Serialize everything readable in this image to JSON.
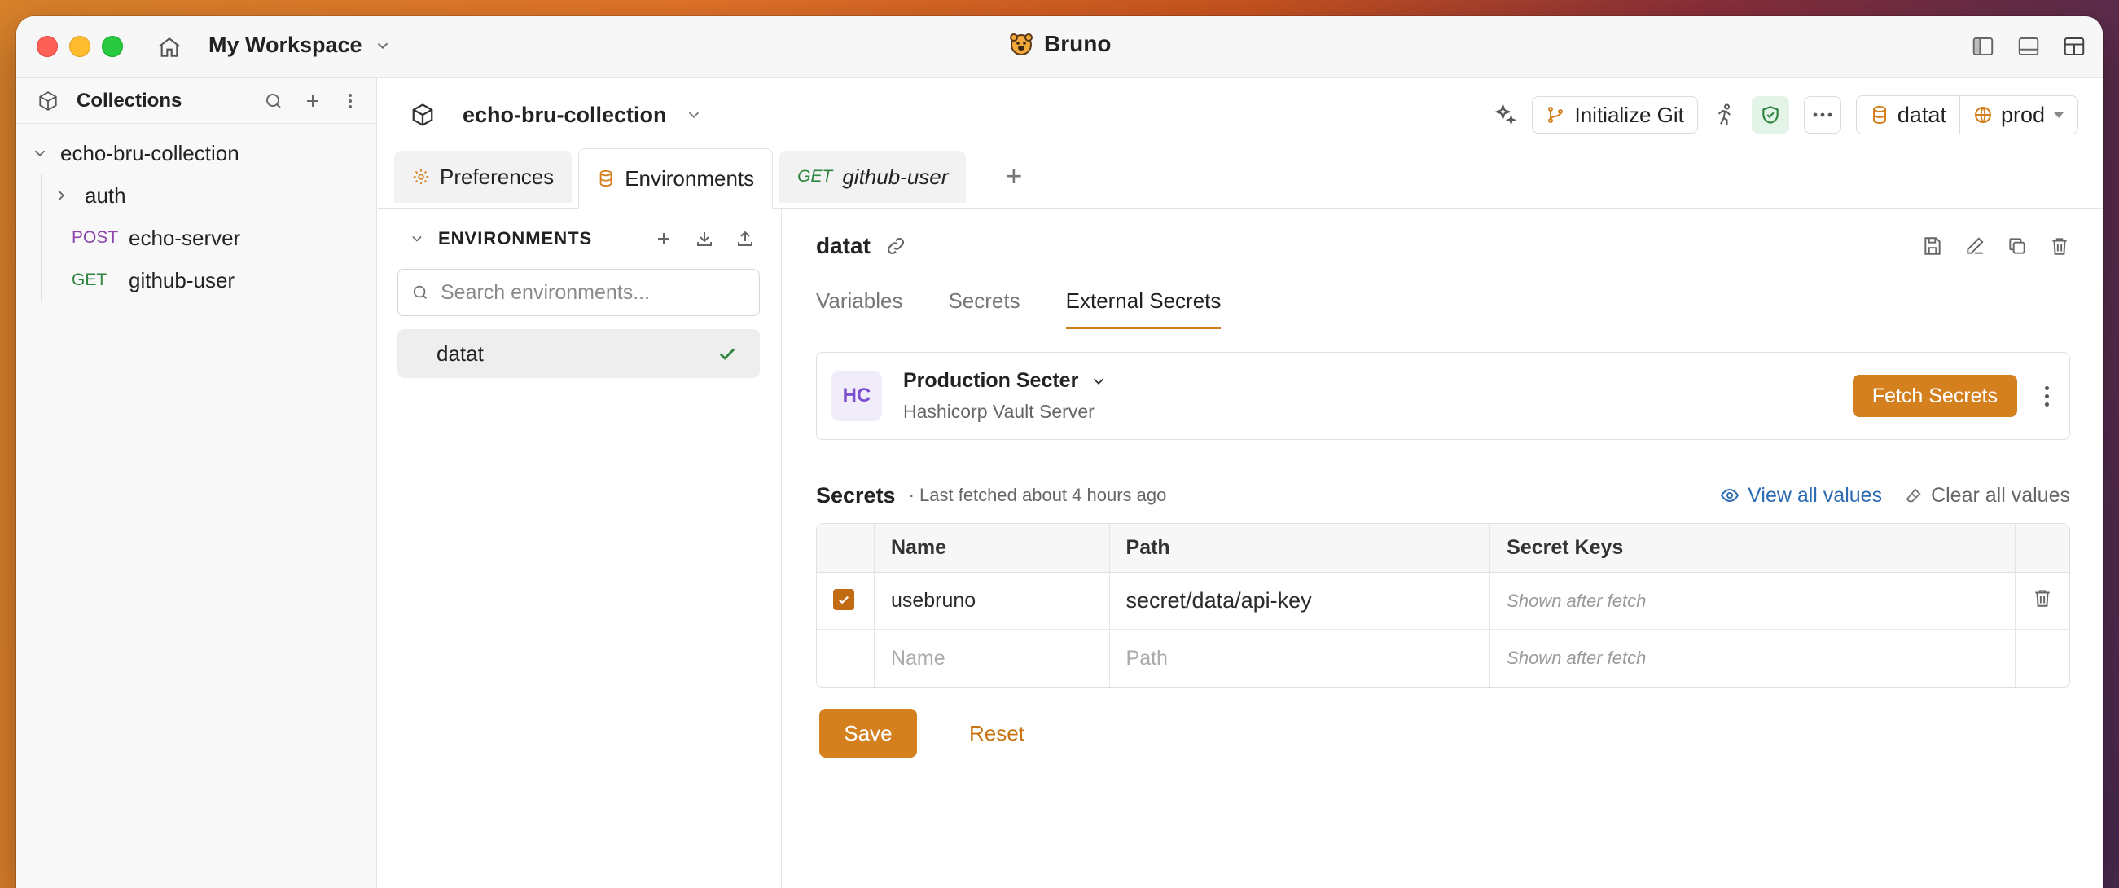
{
  "titlebar": {
    "workspace": "My Workspace",
    "app_name": "Bruno"
  },
  "sidebar": {
    "title": "Collections",
    "collection": "echo-bru-collection",
    "items": [
      {
        "method": "",
        "label": "auth"
      },
      {
        "method": "POST",
        "label": "echo-server"
      },
      {
        "method": "GET",
        "label": "github-user"
      }
    ]
  },
  "topbar": {
    "collection_name": "echo-bru-collection",
    "init_git": "Initialize Git",
    "env_name": "datat",
    "global_env": "prod"
  },
  "tabs": [
    {
      "label": "Preferences"
    },
    {
      "label": "Environments"
    },
    {
      "method": "GET",
      "label": "github-user"
    }
  ],
  "env_panel": {
    "title": "ENVIRONMENTS",
    "search_placeholder": "Search environments...",
    "items": [
      {
        "name": "datat",
        "selected": true
      }
    ]
  },
  "detail": {
    "env_name": "datat",
    "subtabs": [
      "Variables",
      "Secrets",
      "External Secrets"
    ],
    "active_subtab": "External Secrets",
    "provider": {
      "badge": "HC",
      "name": "Production Secter",
      "type": "Hashicorp Vault Server",
      "fetch_label": "Fetch Secrets"
    },
    "secrets": {
      "title": "Secrets",
      "meta": "· Last fetched about 4 hours ago",
      "view_all": "View all values",
      "clear_all": "Clear all values",
      "columns": [
        "Name",
        "Path",
        "Secret Keys"
      ],
      "rows": [
        {
          "enabled": true,
          "name": "usebruno",
          "path": "secret/data/api-key",
          "keys": "Shown after fetch"
        }
      ],
      "new_row": {
        "name_placeholder": "Name",
        "path_placeholder": "Path",
        "keys": "Shown after fetch"
      }
    },
    "save_label": "Save",
    "reset_label": "Reset"
  },
  "colors": {
    "accent": "#d4801f",
    "hc_badge": "#7b4fd0",
    "post": "#8e44ad",
    "get": "#2e8540",
    "link": "#2d6cb3"
  }
}
